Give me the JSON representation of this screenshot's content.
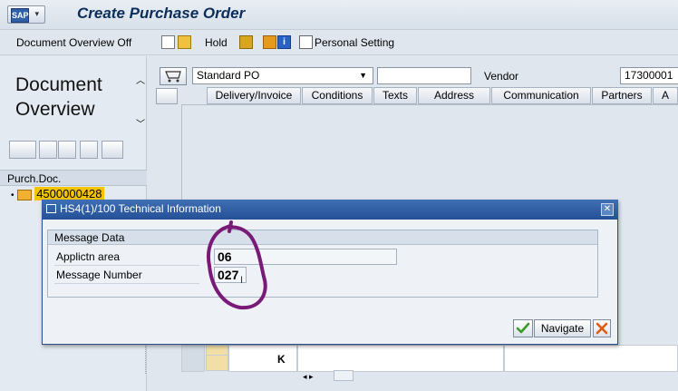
{
  "window": {
    "title": "Create Purchase Order"
  },
  "toolbar": {
    "doc_overview_toggle": "Document Overview Off",
    "hold": "Hold",
    "personal_setting": "Personal Setting"
  },
  "left_panel": {
    "title_line1": "Document",
    "title_line2": "Overview",
    "column_header": "Purch.Doc.",
    "tree_item": "4500000428"
  },
  "header": {
    "doc_type": "Standard PO",
    "vendor_label": "Vendor",
    "vendor_value": "17300001"
  },
  "tabs": [
    "Delivery/Invoice",
    "Conditions",
    "Texts",
    "Address",
    "Communication",
    "Partners",
    "A"
  ],
  "grid": {
    "k_value": "K"
  },
  "dialog": {
    "title": "HS4(1)/100 Technical Information",
    "group_title": "Message Data",
    "fields": [
      {
        "label": "Applictn area",
        "value": "06"
      },
      {
        "label": "Message Number",
        "value": "027"
      }
    ],
    "navigate": "Navigate"
  },
  "colors": {
    "dialog_title": "#245096",
    "accent_title": "#0b2d5a",
    "annotation": "#7a1a78"
  }
}
